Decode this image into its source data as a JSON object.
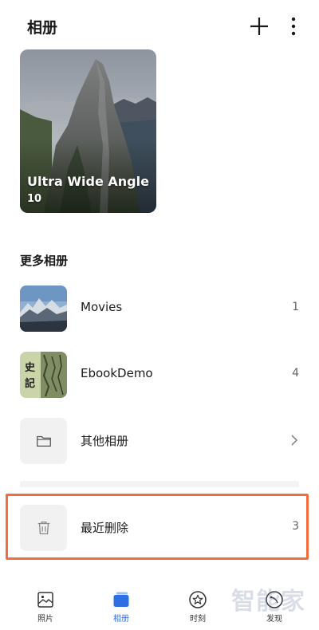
{
  "header": {
    "title": "相册"
  },
  "featured_album": {
    "name": "Ultra Wide Angle",
    "count": "10"
  },
  "more_albums": {
    "title": "更多相册",
    "items": [
      {
        "name": "Movies",
        "count": "1"
      },
      {
        "name": "EbookDemo",
        "count": "4"
      },
      {
        "name": "其他相册"
      }
    ]
  },
  "recently_deleted": {
    "name": "最近删除",
    "count": "3"
  },
  "bottom_nav": [
    {
      "label": "照片",
      "icon": "photos-icon",
      "active": false
    },
    {
      "label": "相册",
      "icon": "albums-icon",
      "active": true
    },
    {
      "label": "时刻",
      "icon": "moments-icon",
      "active": false
    },
    {
      "label": "发现",
      "icon": "discover-icon",
      "active": false
    }
  ],
  "watermark": "智能家",
  "colors": {
    "accent": "#2f6fe4",
    "highlight_border": "#f26d3d"
  }
}
